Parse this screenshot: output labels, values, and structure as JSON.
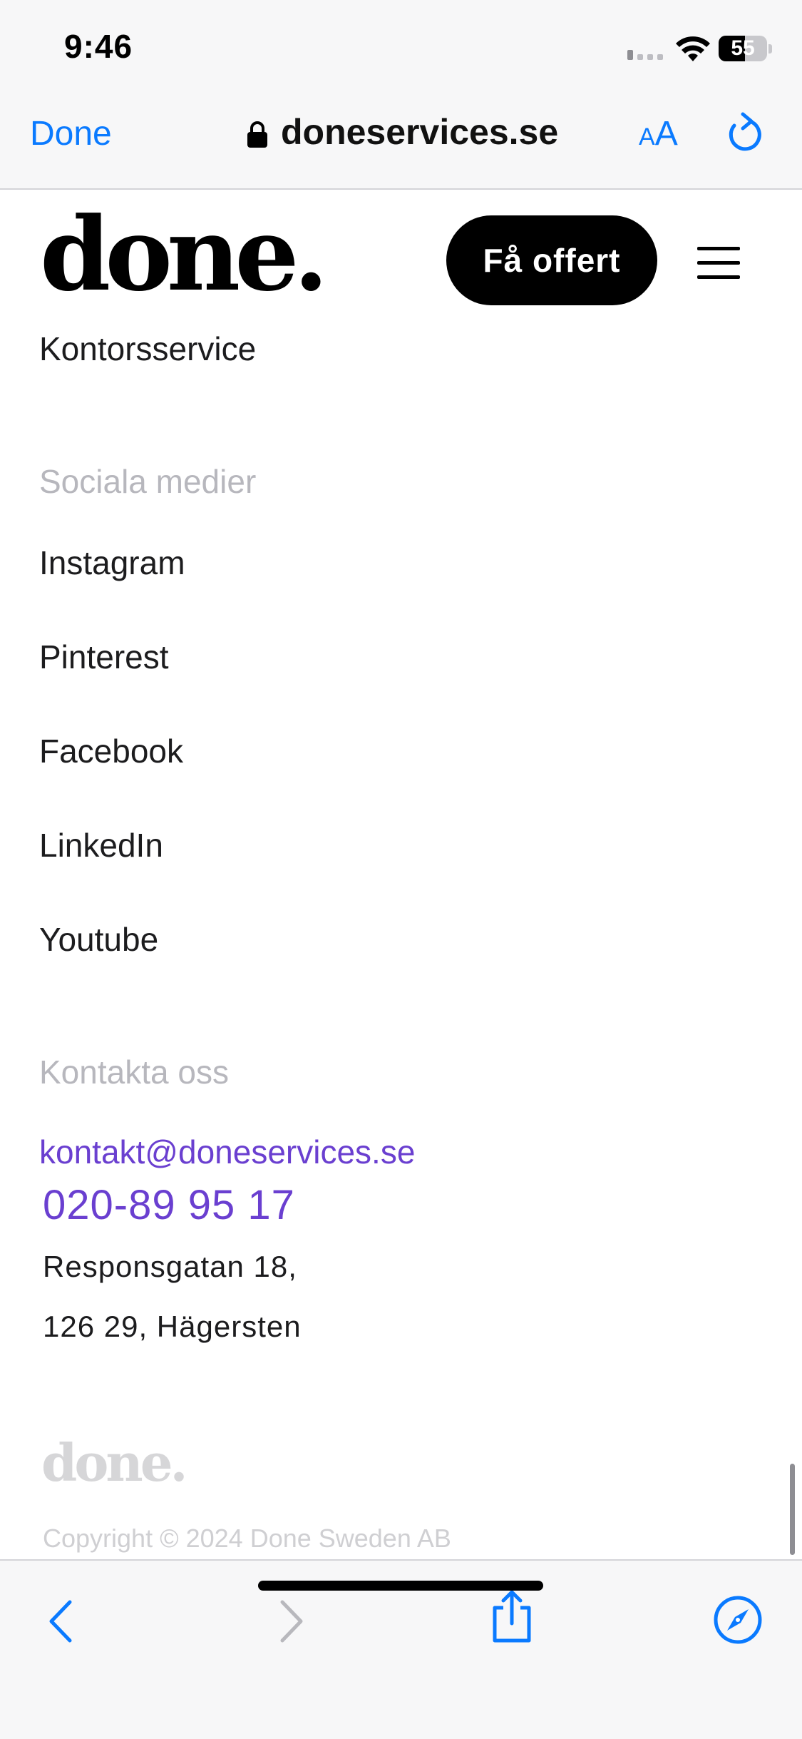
{
  "status": {
    "time": "9:46",
    "battery": "55"
  },
  "browser": {
    "done_label": "Done",
    "url": "doneservices.se",
    "text_size_small": "A",
    "text_size_large": "A"
  },
  "site": {
    "logo": "done.",
    "cta_label": "Få offert"
  },
  "footer": {
    "services_last_item": "Kontorsservice",
    "social": {
      "heading": "Sociala medier",
      "items": [
        "Instagram",
        "Pinterest",
        "Facebook",
        "LinkedIn",
        "Youtube"
      ]
    },
    "contact": {
      "heading": "Kontakta oss",
      "email": "kontakt@doneservices.se",
      "phone": "020-89 95 17",
      "address_line1": "Responsgatan 18,",
      "address_line2": "126 29, Hägersten"
    },
    "logo": "done.",
    "copyright": "Copyright © 2024 Done Sweden AB"
  },
  "colors": {
    "accent_blue": "#0a7aff",
    "link_purple": "#6a3fd0",
    "muted_heading": "#b7b7bd"
  },
  "icons": [
    "lock-icon",
    "reload-icon",
    "menu-icon",
    "back-icon",
    "forward-icon",
    "share-icon",
    "compass-icon"
  ]
}
